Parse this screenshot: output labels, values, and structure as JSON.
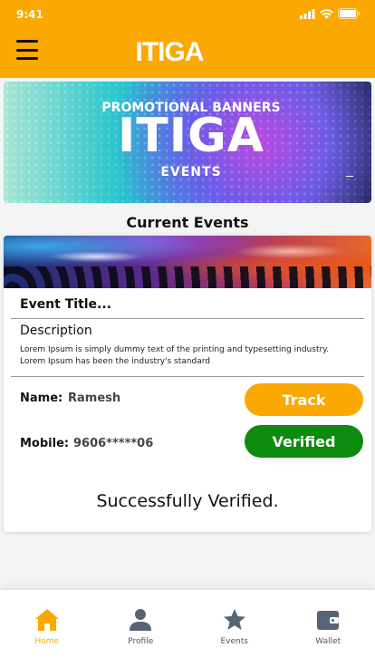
{
  "status_bar": {
    "time": "9:41"
  },
  "header": {
    "title": "ITIGA"
  },
  "banner": {
    "subtitle": "PROMOTIONAL BANNERS",
    "headline": "ITIGA",
    "tagline": "EVENTS"
  },
  "section": {
    "title": "Current Events"
  },
  "event_card": {
    "title": "Event Title...",
    "description_label": "Description",
    "description_text": "Lorem Ipsum is simply dummy text of the printing and typesetting industry. Lorem Ipsum has been the industry's standard",
    "name_label": "Name:",
    "name_value": "Ramesh",
    "mobile_label": "Mobile:",
    "mobile_value": "9606*****06",
    "track_label": "Track",
    "verified_label": "Verified",
    "success_message": "Successfully Verified."
  },
  "tabs": [
    {
      "label": "Home",
      "icon": "home-icon",
      "active": true
    },
    {
      "label": "Profile",
      "icon": "user-icon",
      "active": false
    },
    {
      "label": "Events",
      "icon": "star-icon",
      "active": false
    },
    {
      "label": "Wallet",
      "icon": "wallet-icon",
      "active": false
    }
  ],
  "colors": {
    "accent": "#fba801",
    "success": "#0e8a0e",
    "icon_inactive": "#566576"
  }
}
